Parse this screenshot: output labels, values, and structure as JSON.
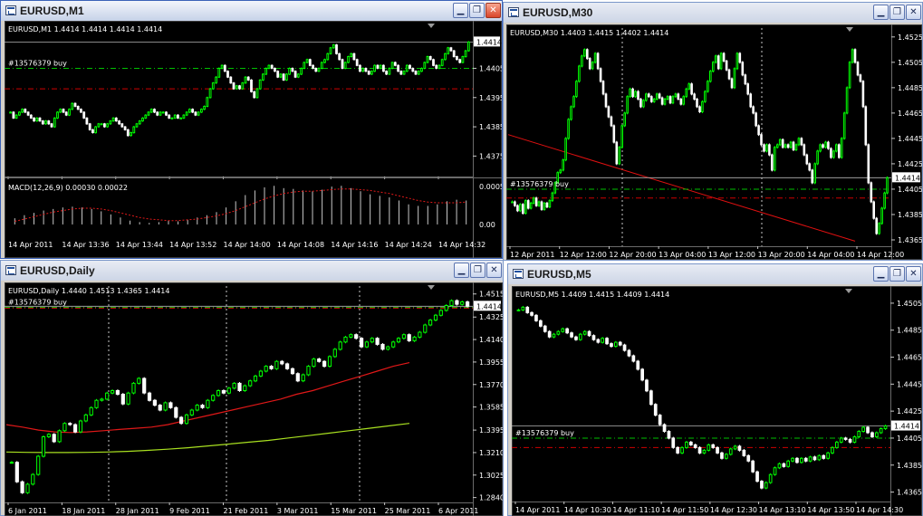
{
  "colors": {
    "bull": "#00ff00",
    "bear": "#ffffff",
    "label": "#ffffff",
    "buy_line": "#00c000",
    "stop_line": "#d00000",
    "bid_line": "#b4b4b4",
    "ma_fast": "#e01818",
    "ma_slow": "#a8e020",
    "trendline": "#e01010",
    "macd_signal": "#e01818",
    "macd_hist": "#c8c8c8"
  },
  "windows": [
    {
      "id": "m1",
      "title": "EURUSD,M1",
      "buttons": {
        "minimize_icon": "minimize-icon",
        "restore_icon": "restore-icon",
        "close_icon": "close-icon"
      },
      "minimize_glyph": "▁",
      "restore_glyph": "❐",
      "close_glyph": "✕",
      "active": true,
      "info": "EURUSD,M1  1.4414 1.4414 1.4414 1.4414",
      "order_label": "#13576379 buy",
      "current_price": "1.4414",
      "chart_data": {
        "type": "candlestick",
        "ylim": [
          1.4368,
          1.442
        ],
        "y_ticks": [
          "1.4405",
          "1.4395",
          "1.4385",
          "1.4375"
        ],
        "x_ticks": [
          "14 Apr 2011",
          "14 Apr 13:36",
          "14 Apr 13:44",
          "14 Apr 13:52",
          "14 Apr 14:00",
          "14 Apr 14:08",
          "14 Apr 14:16",
          "14 Apr 14:24",
          "14 Apr 14:32"
        ],
        "bid": 1.4414,
        "order_price": 1.4405,
        "stop_price": 1.4398,
        "points": [
          1.439,
          1.4388,
          1.4389,
          1.439,
          1.4391,
          1.439,
          1.4389,
          1.4388,
          1.4387,
          1.4388,
          1.4387,
          1.4386,
          1.4387,
          1.4386,
          1.4385,
          1.4388,
          1.439,
          1.4391,
          1.439,
          1.4389,
          1.4391,
          1.4393,
          1.4392,
          1.4391,
          1.439,
          1.4388,
          1.4386,
          1.4384,
          1.4383,
          1.4385,
          1.4386,
          1.4386,
          1.4385,
          1.4386,
          1.4387,
          1.4388,
          1.4387,
          1.4386,
          1.4385,
          1.4384,
          1.4382,
          1.4383,
          1.4385,
          1.4386,
          1.4387,
          1.4388,
          1.4389,
          1.439,
          1.4391,
          1.439,
          1.4389,
          1.439,
          1.439,
          1.4389,
          1.4388,
          1.4388,
          1.4389,
          1.4388,
          1.4388,
          1.4389,
          1.439,
          1.4391,
          1.439,
          1.4389,
          1.439,
          1.4391,
          1.4392,
          1.4395,
          1.4398,
          1.44,
          1.4402,
          1.4405,
          1.4406,
          1.4404,
          1.4402,
          1.44,
          1.4398,
          1.4399,
          1.4398,
          1.44,
          1.4402,
          1.4401,
          1.4397,
          1.4395,
          1.4398,
          1.4401,
          1.4403,
          1.4405,
          1.4406,
          1.4405,
          1.4404,
          1.4402,
          1.4403,
          1.4401,
          1.4403,
          1.4405,
          1.4404,
          1.4402,
          1.4403,
          1.4405,
          1.4407,
          1.4408,
          1.4406,
          1.4405,
          1.4404,
          1.4405,
          1.4407,
          1.4408,
          1.441,
          1.4412,
          1.4413,
          1.441,
          1.4408,
          1.4405,
          1.4407,
          1.4409,
          1.441,
          1.4408,
          1.4406,
          1.4404,
          1.4405,
          1.4404,
          1.4403,
          1.4404,
          1.4406,
          1.4405,
          1.4406,
          1.4404,
          1.4403,
          1.4405,
          1.4407,
          1.4406,
          1.4404,
          1.4403,
          1.4404,
          1.4406,
          1.4405,
          1.4404,
          1.4403,
          1.4404,
          1.4405,
          1.4407,
          1.4409,
          1.4408,
          1.4406,
          1.4405,
          1.4406,
          1.4408,
          1.441,
          1.4412,
          1.4411,
          1.4409,
          1.4408,
          1.4407,
          1.4409,
          1.4411,
          1.4414
        ]
      },
      "macd": {
        "label": "MACD(12,26,9) 0.00030 0.00022",
        "y_ticks": [
          "0.00051",
          "0.00"
        ],
        "ylim": [
          -0.0002,
          0.00055
        ],
        "hist": [
          8e-05,
          0.00012,
          0.00015,
          0.00018,
          0.0002,
          0.00022,
          0.00023,
          0.00022,
          0.0002,
          0.00017,
          0.00013,
          9e-05,
          5e-05,
          3e-05,
          2e-05,
          3e-05,
          5e-05,
          4e-05,
          6e-05,
          9e-05,
          0.00012,
          0.00016,
          0.00022,
          0.0003,
          0.00038,
          0.00044,
          0.00048,
          0.0005,
          0.00047,
          0.00046,
          0.00044,
          0.00043,
          0.00045,
          0.00049,
          0.0005,
          0.00047,
          0.00043,
          0.00039,
          0.00037,
          0.00035,
          0.00031,
          0.00026,
          0.00024,
          0.00024,
          0.00026,
          0.0003,
          0.00032,
          0.00031
        ],
        "signal": [
          4e-05,
          7e-05,
          0.0001,
          0.00013,
          0.00016,
          0.00018,
          0.0002,
          0.00021,
          0.00021,
          0.0002,
          0.00018,
          0.00015,
          0.00012,
          9e-05,
          7e-05,
          6e-05,
          5e-05,
          5e-05,
          6e-05,
          7e-05,
          9e-05,
          0.00011,
          0.00014,
          0.00018,
          0.00023,
          0.00028,
          0.00033,
          0.00037,
          0.0004,
          0.00042,
          0.00043,
          0.00043,
          0.00044,
          0.00045,
          0.00046,
          0.00046,
          0.00045,
          0.00044,
          0.00042,
          0.0004,
          0.00037,
          0.00034,
          0.00031,
          0.00029,
          0.00028,
          0.00028,
          0.00028,
          0.00029
        ]
      }
    },
    {
      "id": "m30",
      "title": "EURUSD,M30",
      "buttons": {
        "minimize_icon": "minimize-icon",
        "restore_icon": "restore-icon",
        "close_icon": "close-icon"
      },
      "minimize_glyph": "▁",
      "restore_glyph": "❐",
      "close_glyph": "✕",
      "active": false,
      "info": "EURUSD,M30  1.4403 1.4415 1.4402 1.4414",
      "order_label": "#13576379 buy",
      "current_price": "1.4414",
      "chart_data": {
        "type": "candlestick",
        "ylim": [
          1.436,
          1.4532
        ],
        "y_ticks": [
          "1.4525",
          "1.4505",
          "1.4485",
          "1.4465",
          "1.4445",
          "1.4425",
          "1.4405",
          "1.4385",
          "1.4365"
        ],
        "x_ticks": [
          "12 Apr 2011",
          "12 Apr 12:00",
          "12 Apr 20:00",
          "13 Apr 04:00",
          "13 Apr 12:00",
          "13 Apr 20:00",
          "14 Apr 04:00",
          "14 Apr 12:00"
        ],
        "bid": 1.4414,
        "order_price": 1.4405,
        "stop_price": 1.4398,
        "trendline": [
          [
            0,
            1.4448
          ],
          [
            1,
            1.4364
          ]
        ],
        "points": [
          1.4395,
          1.4392,
          1.4388,
          1.4393,
          1.4386,
          1.4396,
          1.439,
          1.4394,
          1.4398,
          1.4392,
          1.4395,
          1.4389,
          1.4394,
          1.4391,
          1.4396,
          1.4402,
          1.441,
          1.4418,
          1.442,
          1.4428,
          1.4445,
          1.446,
          1.447,
          1.4478,
          1.449,
          1.4502,
          1.451,
          1.4515,
          1.4508,
          1.45,
          1.4505,
          1.4512,
          1.45,
          1.449,
          1.448,
          1.447,
          1.4462,
          1.4455,
          1.4442,
          1.4425,
          1.4438,
          1.4455,
          1.4465,
          1.4478,
          1.4484,
          1.4478,
          1.4482,
          1.4476,
          1.447,
          1.4475,
          1.448,
          1.4478,
          1.4474,
          1.4476,
          1.448,
          1.4477,
          1.4472,
          1.4476,
          1.4478,
          1.4473,
          1.4478,
          1.448,
          1.4476,
          1.4472,
          1.4478,
          1.4484,
          1.4488,
          1.448,
          1.4476,
          1.447,
          1.4466,
          1.4474,
          1.4482,
          1.449,
          1.4498,
          1.4505,
          1.451,
          1.45,
          1.4512,
          1.4506,
          1.4499,
          1.4492,
          1.4485,
          1.45,
          1.4512,
          1.4505,
          1.4495,
          1.4488,
          1.448,
          1.447,
          1.4465,
          1.4455,
          1.4448,
          1.444,
          1.4435,
          1.444,
          1.4432,
          1.442,
          1.4438,
          1.444,
          1.4444,
          1.4438,
          1.444,
          1.4438,
          1.4442,
          1.4436,
          1.444,
          1.4445,
          1.444,
          1.4432,
          1.4425,
          1.442,
          1.441,
          1.4425,
          1.4435,
          1.444,
          1.4438,
          1.4442,
          1.4437,
          1.443,
          1.4435,
          1.444,
          1.443,
          1.4445,
          1.4465,
          1.4485,
          1.4505,
          1.4515,
          1.4505,
          1.4495,
          1.449,
          1.447,
          1.444,
          1.441,
          1.4395,
          1.4382,
          1.437,
          1.4378,
          1.439,
          1.4402,
          1.4414
        ]
      }
    },
    {
      "id": "daily",
      "title": "EURUSD,Daily",
      "buttons": {
        "minimize_icon": "minimize-icon",
        "restore_icon": "restore-icon",
        "close_icon": "close-icon"
      },
      "minimize_glyph": "▁",
      "restore_glyph": "❐",
      "close_glyph": "✕",
      "active": false,
      "info": "EURUSD,Daily  1.4440 1.4513 1.4365 1.4414",
      "order_label": "#13576379 buy",
      "current_price": "1.4414",
      "chart_data": {
        "type": "candlestick",
        "ylim": [
          1.28,
          1.458
        ],
        "y_ticks": [
          "1.4515",
          "1.4325",
          "1.4140",
          "1.3955",
          "1.3770",
          "1.3585",
          "1.3395",
          "1.3210",
          "1.3025",
          "1.2840"
        ],
        "x_ticks": [
          "6 Jan 2011",
          "18 Jan 2011",
          "28 Jan 2011",
          "9 Feb 2011",
          "21 Feb 2011",
          "3 Mar 2011",
          "15 Mar 2011",
          "25 Mar 2011",
          "6 Apr 2011"
        ],
        "bid": 1.4414,
        "order_price": 1.4405,
        "stop_price": 1.4398,
        "points": [
          1.313,
          1.297,
          1.288,
          1.295,
          1.303,
          1.318,
          1.334,
          1.336,
          1.33,
          1.339,
          1.345,
          1.344,
          1.338,
          1.347,
          1.352,
          1.358,
          1.364,
          1.365,
          1.37,
          1.372,
          1.369,
          1.361,
          1.37,
          1.378,
          1.382,
          1.37,
          1.364,
          1.36,
          1.356,
          1.362,
          1.358,
          1.35,
          1.345,
          1.352,
          1.356,
          1.36,
          1.358,
          1.364,
          1.368,
          1.372,
          1.37,
          1.374,
          1.378,
          1.372,
          1.376,
          1.38,
          1.384,
          1.388,
          1.392,
          1.39,
          1.396,
          1.394,
          1.39,
          1.386,
          1.38,
          1.385,
          1.392,
          1.398,
          1.396,
          1.392,
          1.4,
          1.406,
          1.412,
          1.416,
          1.418,
          1.415,
          1.408,
          1.412,
          1.415,
          1.41,
          1.406,
          1.408,
          1.412,
          1.415,
          1.418,
          1.413,
          1.416,
          1.42,
          1.426,
          1.43,
          1.434,
          1.438,
          1.442,
          1.446,
          1.443,
          1.445,
          1.4414
        ],
        "ma_fast": [
          1.344,
          1.342,
          1.3395,
          1.338,
          1.3375,
          1.338,
          1.339,
          1.34,
          1.341,
          1.342,
          1.344,
          1.347,
          1.35,
          1.353,
          1.356,
          1.359,
          1.362,
          1.365,
          1.369,
          1.372,
          1.376,
          1.38,
          1.384,
          1.388,
          1.392,
          1.395
        ],
        "ma_slow": [
          1.3215,
          1.3212,
          1.321,
          1.321,
          1.3212,
          1.3215,
          1.322,
          1.3228,
          1.3238,
          1.325,
          1.3265,
          1.328,
          1.3295,
          1.331,
          1.333,
          1.335,
          1.337,
          1.339,
          1.341,
          1.343,
          1.345
        ]
      }
    },
    {
      "id": "m5",
      "title": "EURUSD,M5",
      "buttons": {
        "minimize_icon": "minimize-icon",
        "restore_icon": "restore-icon",
        "close_icon": "close-icon"
      },
      "minimize_glyph": "▁",
      "restore_glyph": "❐",
      "close_glyph": "✕",
      "active": false,
      "info": "EURUSD,M5  1.4409 1.4415 1.4409 1.4414",
      "order_label": "#13576379 buy",
      "current_price": "1.4414",
      "chart_data": {
        "type": "candlestick",
        "ylim": [
          1.4358,
          1.4515
        ],
        "y_ticks": [
          "1.4505",
          "1.4485",
          "1.4465",
          "1.4445",
          "1.4425",
          "1.4405",
          "1.4385",
          "1.4365"
        ],
        "x_ticks": [
          "14 Apr 2011",
          "14 Apr 10:30",
          "14 Apr 11:10",
          "14 Apr 11:50",
          "14 Apr 12:30",
          "14 Apr 13:10",
          "14 Apr 13:50",
          "14 Apr 14:30"
        ],
        "bid": 1.4414,
        "order_price": 1.4405,
        "stop_price": 1.4398,
        "points": [
          1.45,
          1.4502,
          1.4498,
          1.4496,
          1.4492,
          1.4488,
          1.4484,
          1.448,
          1.4482,
          1.4484,
          1.4486,
          1.4483,
          1.448,
          1.4478,
          1.4482,
          1.4484,
          1.4481,
          1.4478,
          1.4476,
          1.4479,
          1.4475,
          1.4473,
          1.4476,
          1.4474,
          1.447,
          1.4466,
          1.4462,
          1.4456,
          1.4448,
          1.444,
          1.443,
          1.4422,
          1.4415,
          1.441,
          1.4405,
          1.4398,
          1.4394,
          1.4398,
          1.4402,
          1.44,
          1.4398,
          1.4394,
          1.4396,
          1.44,
          1.4398,
          1.4394,
          1.439,
          1.4393,
          1.4397,
          1.4399,
          1.4396,
          1.4392,
          1.4388,
          1.438,
          1.4373,
          1.4368,
          1.4372,
          1.4378,
          1.4383,
          1.4386,
          1.4384,
          1.4388,
          1.439,
          1.4387,
          1.439,
          1.4388,
          1.4391,
          1.4389,
          1.4392,
          1.439,
          1.4394,
          1.4398,
          1.4402,
          1.4405,
          1.4404,
          1.4402,
          1.4406,
          1.441,
          1.4413,
          1.4409,
          1.4406,
          1.4409,
          1.4412,
          1.4414
        ]
      }
    }
  ]
}
